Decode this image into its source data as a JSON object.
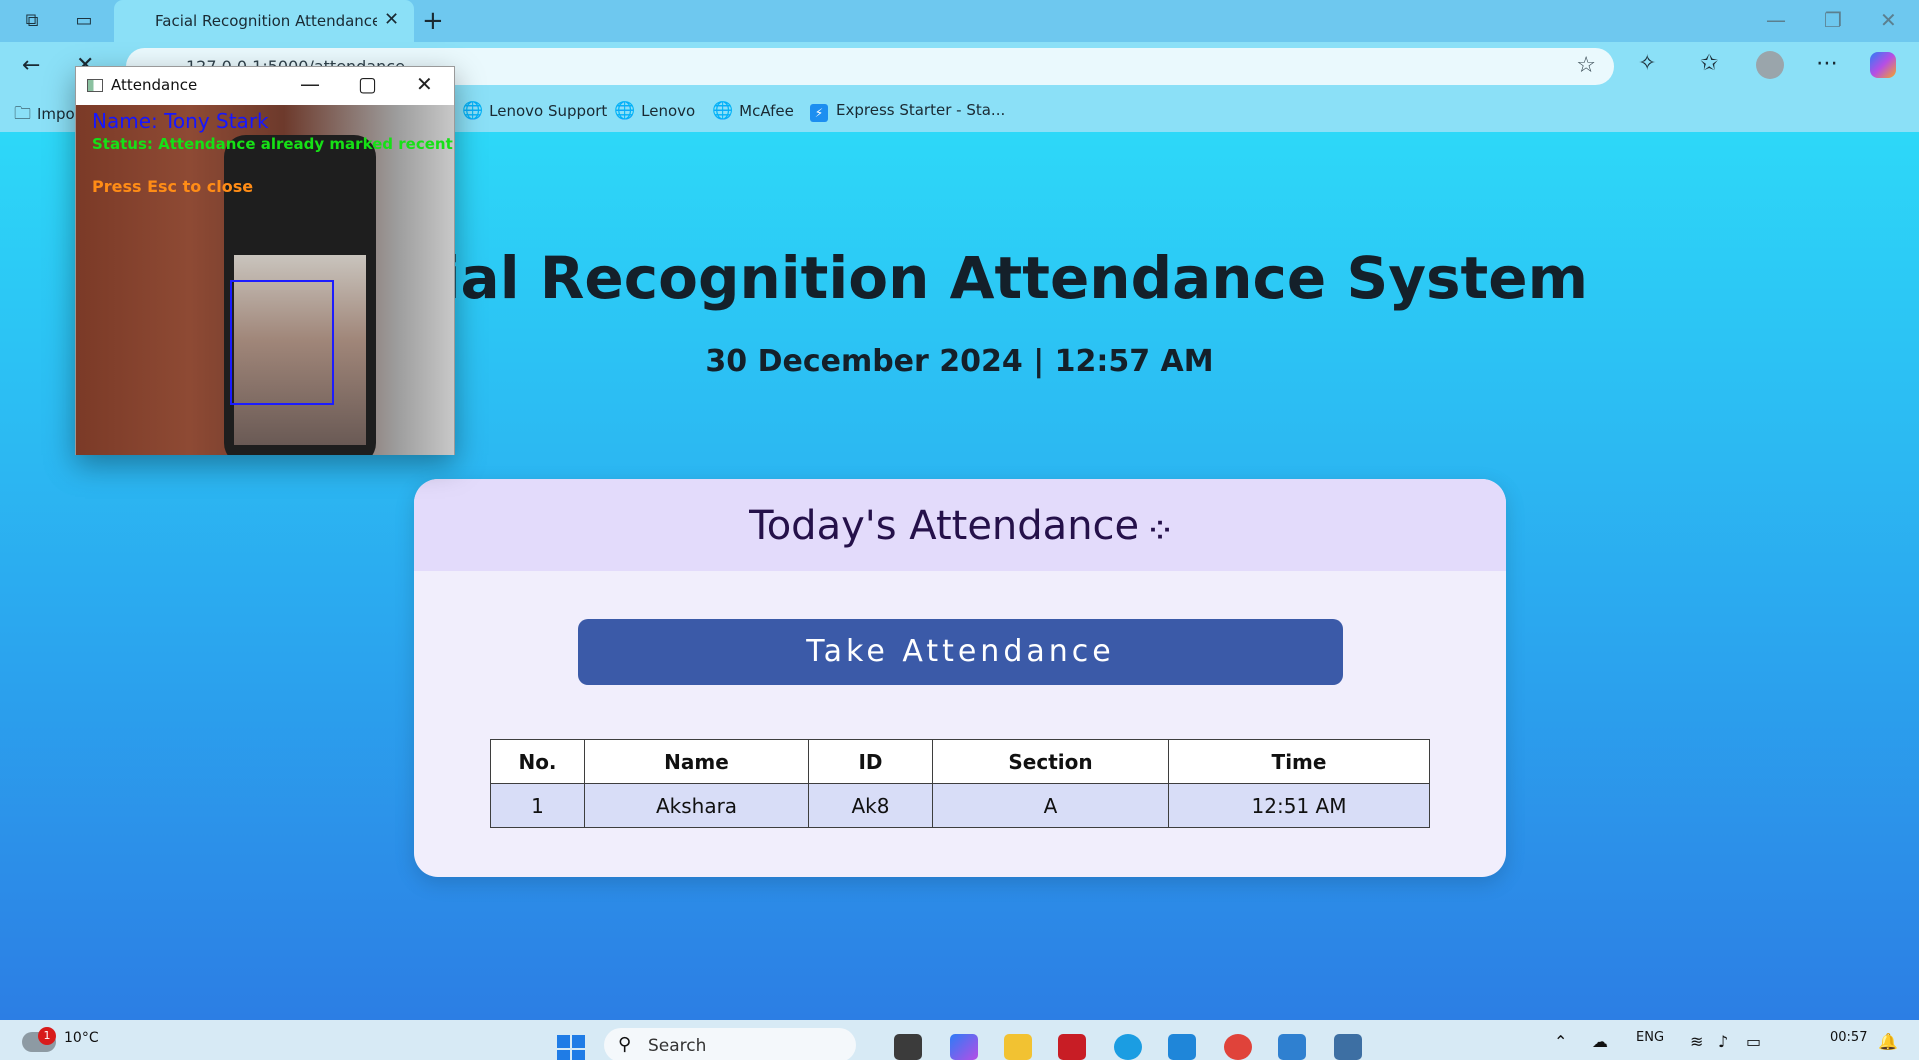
{
  "browser": {
    "tab_title": "Facial Recognition Attendance System",
    "url": "127.0.0.1:5000/attendance",
    "bookmarks": [
      "Impo",
      "Lenovo Support",
      "Lenovo",
      "McAfee",
      "Express Starter - Sta..."
    ]
  },
  "page": {
    "title": "Facial Recognition Attendance System",
    "datetime": "30 December 2024 | 12:57 AM",
    "card_title": "Today's Attendance",
    "button_label": "Take Attendance",
    "table_headers": [
      "No.",
      "Name",
      "ID",
      "Section",
      "Time"
    ],
    "rows": [
      {
        "no": "1",
        "name": "Akshara",
        "id": "Ak8",
        "section": "A",
        "time": "12:51 AM"
      }
    ]
  },
  "camera_window": {
    "title": "Attendance",
    "name_text": "Name: Tony Stark",
    "status_text": "Status: Attendance already marked recently.",
    "esc_text": "Press Esc to close"
  },
  "taskbar": {
    "weather_temp": "10°C",
    "weather_badge": "1",
    "search_placeholder": "Search",
    "lang": "ENG",
    "time": "00:57"
  },
  "icons": {
    "back": "back-arrow-icon",
    "star": "favorite-star-icon",
    "extensions": "puzzle-icon",
    "favorites": "favorites-icon",
    "more": "more-icon"
  },
  "colors": {
    "button": "#3b5aa8",
    "card": "#f1eefc",
    "table_row": "#d8ddf7",
    "cv_name": "#1616ff",
    "cv_status": "#16e016",
    "cv_esc": "#ff8c16",
    "face_box": "#1c1cff"
  }
}
